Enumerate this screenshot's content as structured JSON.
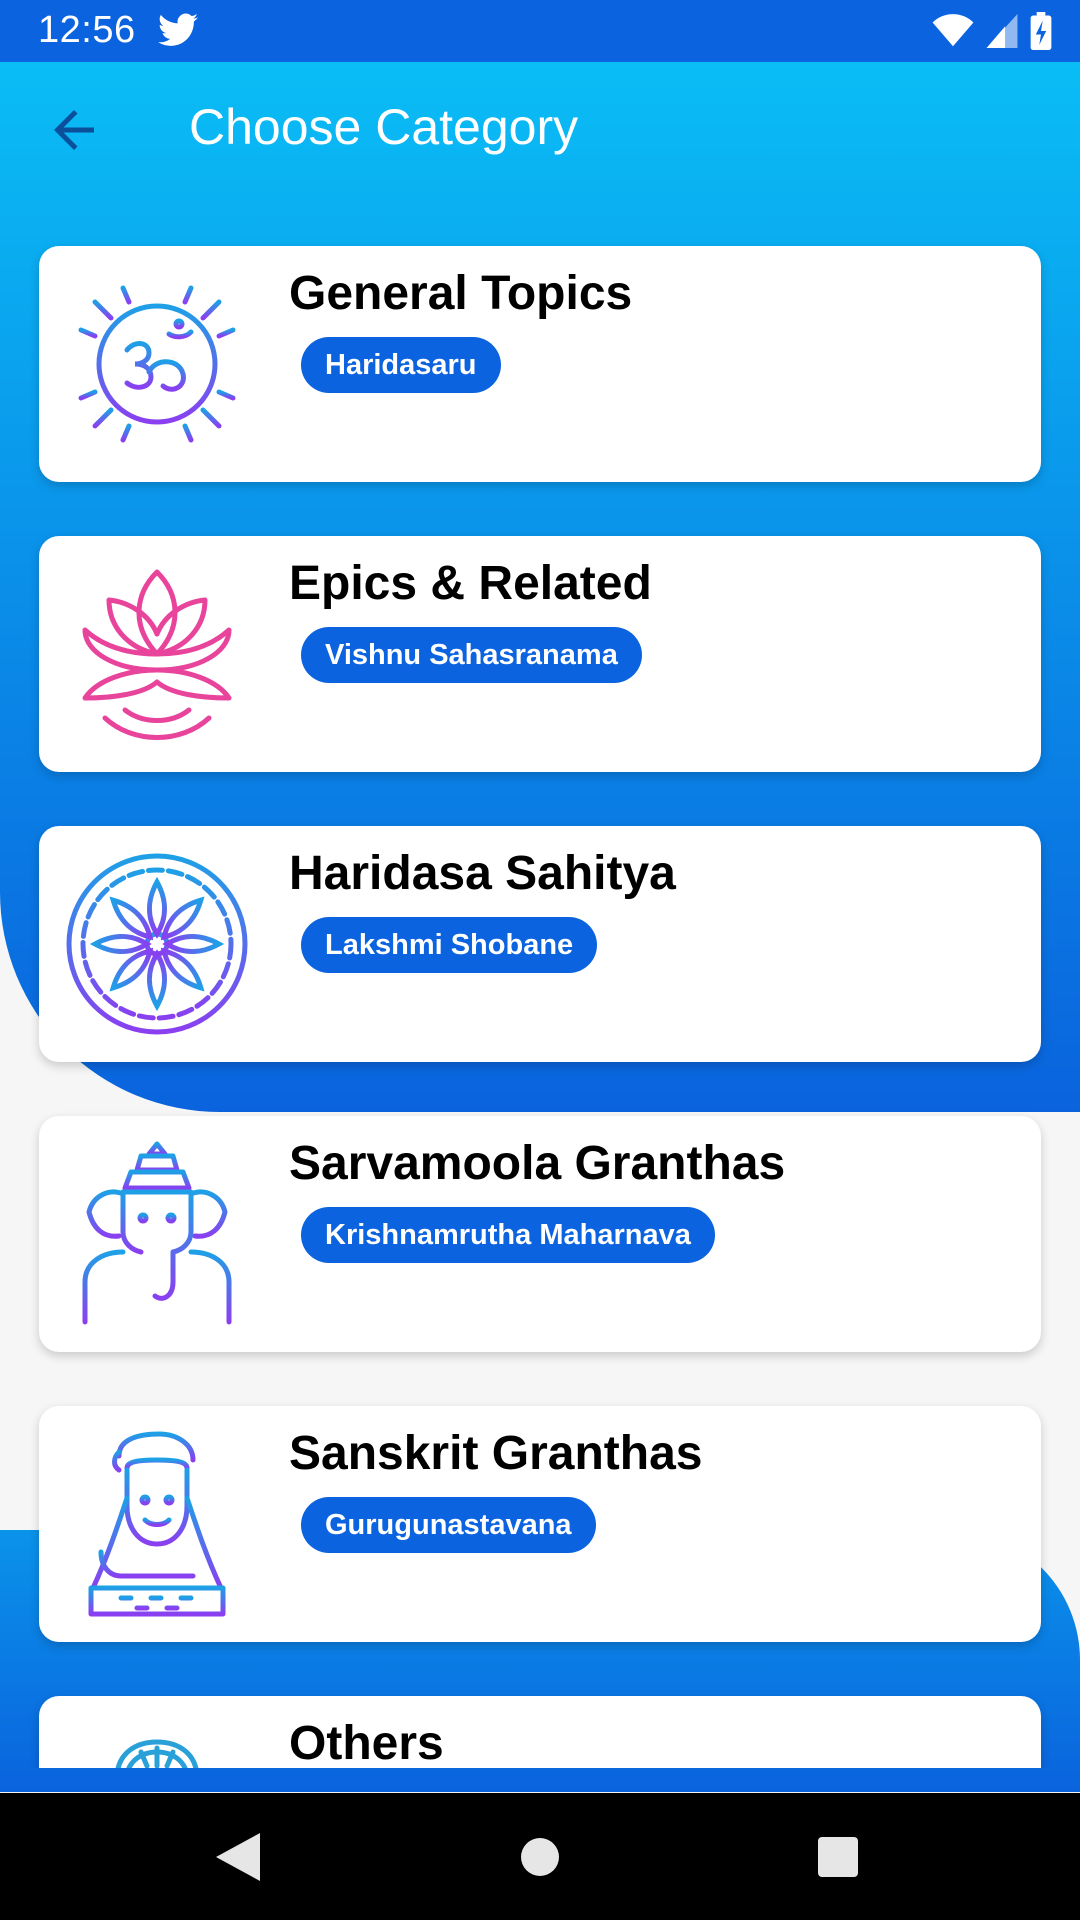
{
  "status_bar": {
    "time": "12:56",
    "notification_icon": "twitter-icon",
    "icons": [
      "wifi-icon",
      "signal-icon",
      "battery-charging-icon"
    ]
  },
  "toolbar": {
    "title": "Choose Category",
    "back_icon": "arrow-left-icon"
  },
  "categories": [
    {
      "name": "General Topics",
      "tag": "Haridasaru",
      "icon": "om-sun-icon"
    },
    {
      "name": "Epics & Related",
      "tag": "Vishnu Sahasranama",
      "icon": "lotus-icon"
    },
    {
      "name": "Haridasa Sahitya",
      "tag": "Lakshmi Shobane",
      "icon": "chakra-flower-icon"
    },
    {
      "name": "Sarvamoola Granthas",
      "tag": "Krishnamrutha Maharnava",
      "icon": "ganesha-icon"
    },
    {
      "name": "Sanskrit Granthas",
      "tag": "Gurugunastavana",
      "icon": "shiva-icon"
    },
    {
      "name": "Others",
      "tag": "",
      "icon": "temple-icon"
    }
  ],
  "nav_bar": {
    "back": "nav-back-icon",
    "home": "nav-home-icon",
    "recents": "nav-recents-icon"
  },
  "colors": {
    "primary": "#0b63e0",
    "gradient_top": "#0abdf5",
    "card_bg": "#ffffff"
  }
}
